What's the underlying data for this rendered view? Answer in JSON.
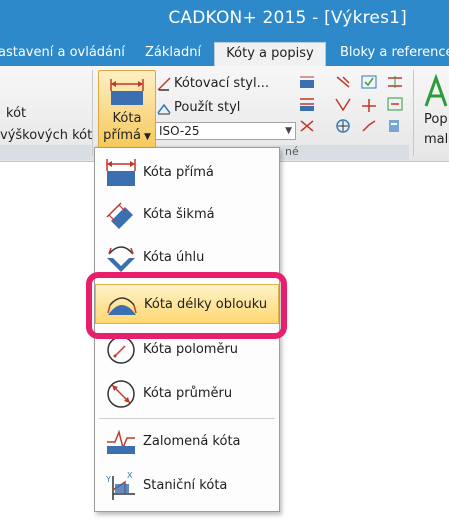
{
  "window": {
    "title": "CADKON+ 2015 - [Výkres1]"
  },
  "tabs": [
    {
      "label": "astavení a ovládání",
      "active": false
    },
    {
      "label": "Základní",
      "active": false
    },
    {
      "label": "Kóty a popisy",
      "active": true
    },
    {
      "label": "Bloky a reference",
      "active": false
    }
  ],
  "ribbon": {
    "left_items": [
      "kót",
      "výškových kót"
    ],
    "big_button": {
      "line1": "Kóta",
      "line2": "přímá"
    },
    "style_button": "Kótovací styl...",
    "use_style_button": "Použít styl",
    "dim_style_value": "ISO-25",
    "group_label_suffix": "né",
    "right_item": [
      "Pop",
      "malé"
    ]
  },
  "dropdown": {
    "items": [
      {
        "label": "Kóta přímá",
        "icon": "linear-dimension-icon"
      },
      {
        "label": "Kóta šikmá",
        "icon": "aligned-dimension-icon"
      },
      {
        "label": "Kóta úhlu",
        "icon": "angular-dimension-icon"
      },
      {
        "label": "Kóta délky oblouku",
        "icon": "arc-length-dimension-icon",
        "selected": true
      },
      {
        "label": "Kóta poloměru",
        "icon": "radius-dimension-icon"
      },
      {
        "label": "Kóta průměru",
        "icon": "diameter-dimension-icon"
      },
      {
        "label": "Zalomená kóta",
        "icon": "jogged-dimension-icon"
      },
      {
        "label": "Staniční kóta",
        "icon": "ordinate-dimension-icon"
      }
    ]
  },
  "colors": {
    "title_bar": "#2d89c9",
    "highlight": "#e8206b",
    "selected_item": "#ffd872"
  }
}
